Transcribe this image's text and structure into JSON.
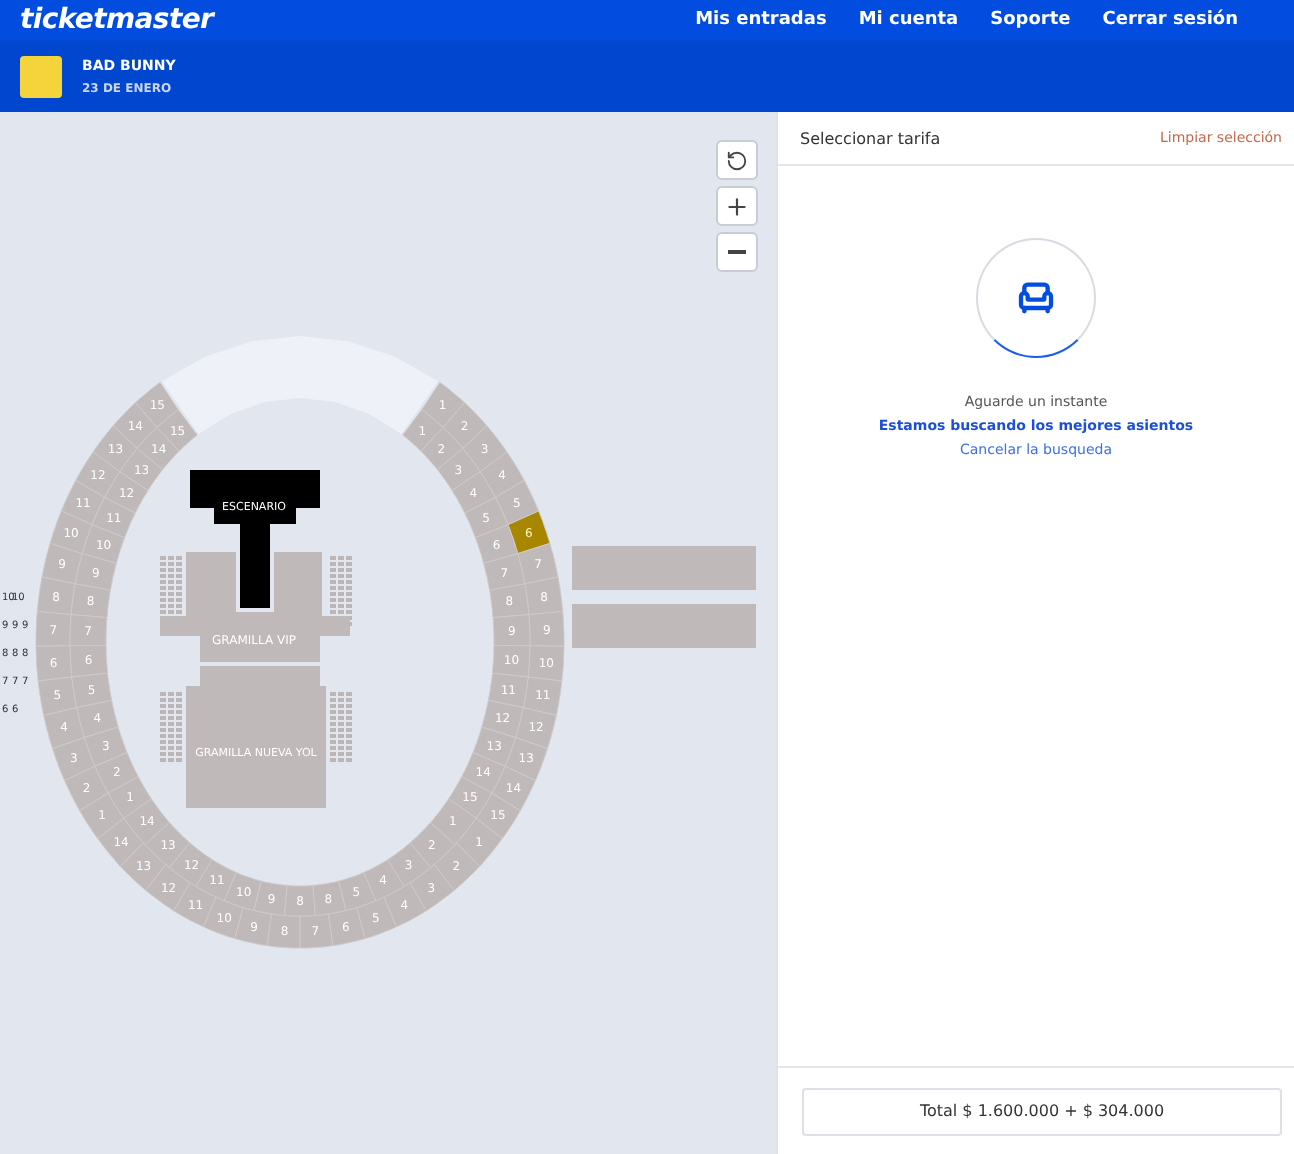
{
  "topbar": {
    "logo": "ticketmaster",
    "links": [
      "Mis entradas",
      "Mi cuenta",
      "Soporte",
      "Cerrar sesión"
    ]
  },
  "event": {
    "name": "BAD BUNNY",
    "date": "23 DE ENERO"
  },
  "map": {
    "stage": "ESCENARIO",
    "fields": [
      "GRAMILLA VIP",
      "GRAMILLA NUEVA YOL"
    ],
    "outer_ring": {
      "right": [
        {
          "label": "1",
          "selected": false
        },
        {
          "label": "2",
          "selected": false
        },
        {
          "label": "3",
          "selected": false
        },
        {
          "label": "4",
          "selected": false
        },
        {
          "label": "5",
          "selected": false
        },
        {
          "label": "6",
          "selected": true
        },
        {
          "label": "7",
          "selected": false
        },
        {
          "label": "8",
          "selected": false
        },
        {
          "label": "9",
          "selected": false
        },
        {
          "label": "10",
          "selected": false
        },
        {
          "label": "11",
          "selected": false
        },
        {
          "label": "12",
          "selected": false
        },
        {
          "label": "13",
          "selected": false
        },
        {
          "label": "14",
          "selected": false
        },
        {
          "label": "15",
          "selected": false
        }
      ],
      "bottom": [
        {
          "label": "14",
          "selected": false
        },
        {
          "label": "13",
          "selected": false
        },
        {
          "label": "12",
          "selected": false
        },
        {
          "label": "11",
          "selected": false
        },
        {
          "label": "10",
          "selected": false
        },
        {
          "label": "9",
          "selected": false
        },
        {
          "label": "8",
          "selected": false
        },
        {
          "label": "7",
          "selected": false
        },
        {
          "label": "6",
          "selected": false
        },
        {
          "label": "5",
          "selected": false
        },
        {
          "label": "4",
          "selected": false
        },
        {
          "label": "3",
          "selected": false
        },
        {
          "label": "2",
          "selected": false
        },
        {
          "label": "1",
          "selected": false
        }
      ],
      "left": [
        {
          "label": "15",
          "selected": false
        },
        {
          "label": "14",
          "selected": false
        },
        {
          "label": "13",
          "selected": false
        },
        {
          "label": "12",
          "selected": false
        },
        {
          "label": "11",
          "selected": false
        },
        {
          "label": "10",
          "selected": false
        },
        {
          "label": "9",
          "selected": false
        },
        {
          "label": "8",
          "selected": false
        },
        {
          "label": "7",
          "selected": false
        },
        {
          "label": "6",
          "selected": false
        },
        {
          "label": "5",
          "selected": false
        },
        {
          "label": "4",
          "selected": false
        },
        {
          "label": "3",
          "selected": false
        },
        {
          "label": "2",
          "selected": false
        },
        {
          "label": "1",
          "selected": false
        }
      ]
    },
    "inner_ring": {
      "right": [
        {
          "label": "1",
          "selected": false
        },
        {
          "label": "2",
          "selected": false
        },
        {
          "label": "3",
          "selected": false
        },
        {
          "label": "4",
          "selected": false
        },
        {
          "label": "5",
          "selected": false
        },
        {
          "label": "6",
          "selected": false
        },
        {
          "label": "7",
          "selected": false
        },
        {
          "label": "8",
          "selected": false
        },
        {
          "label": "9",
          "selected": false
        },
        {
          "label": "10",
          "selected": false
        },
        {
          "label": "11",
          "selected": false
        },
        {
          "label": "12",
          "selected": false
        },
        {
          "label": "13",
          "selected": false
        },
        {
          "label": "14",
          "selected": false
        },
        {
          "label": "15",
          "selected": false
        }
      ],
      "bottom": [
        {
          "label": "14",
          "selected": false
        },
        {
          "label": "13",
          "selected": false
        },
        {
          "label": "12",
          "selected": false
        },
        {
          "label": "11",
          "selected": false
        },
        {
          "label": "10",
          "selected": false
        },
        {
          "label": "9",
          "selected": false
        },
        {
          "label": "8",
          "selected": false
        },
        {
          "label": "8",
          "selected": false
        },
        {
          "label": "5",
          "selected": false
        },
        {
          "label": "4",
          "selected": false
        },
        {
          "label": "3",
          "selected": false
        },
        {
          "label": "2",
          "selected": false
        },
        {
          "label": "1",
          "selected": false
        }
      ],
      "left": [
        {
          "label": "15",
          "selected": false
        },
        {
          "label": "14",
          "selected": false
        },
        {
          "label": "13",
          "selected": false
        },
        {
          "label": "12",
          "selected": false
        },
        {
          "label": "11",
          "selected": false
        },
        {
          "label": "10",
          "selected": false
        },
        {
          "label": "9",
          "selected": false
        },
        {
          "label": "8",
          "selected": false
        },
        {
          "label": "7",
          "selected": false
        },
        {
          "label": "6",
          "selected": false
        },
        {
          "label": "5",
          "selected": false
        },
        {
          "label": "4",
          "selected": false
        },
        {
          "label": "3",
          "selected": false
        },
        {
          "label": "2",
          "selected": false
        },
        {
          "label": "1",
          "selected": false
        }
      ]
    },
    "side_rows": [
      [
        "10",
        "10"
      ],
      [
        "9",
        "9",
        "9"
      ],
      [
        "8",
        "8",
        "8"
      ],
      [
        "7",
        "7",
        "7"
      ],
      [
        "6",
        "6"
      ]
    ]
  },
  "panel": {
    "title": "Seleccionar tarifa",
    "clear": "Limpiar selección",
    "wait": "Aguarde un instante",
    "searching": "Estamos buscando los mejores asientos",
    "cancel": "Cancelar la busqueda",
    "total": "Total $ 1.600.000 + $ 304.000"
  }
}
